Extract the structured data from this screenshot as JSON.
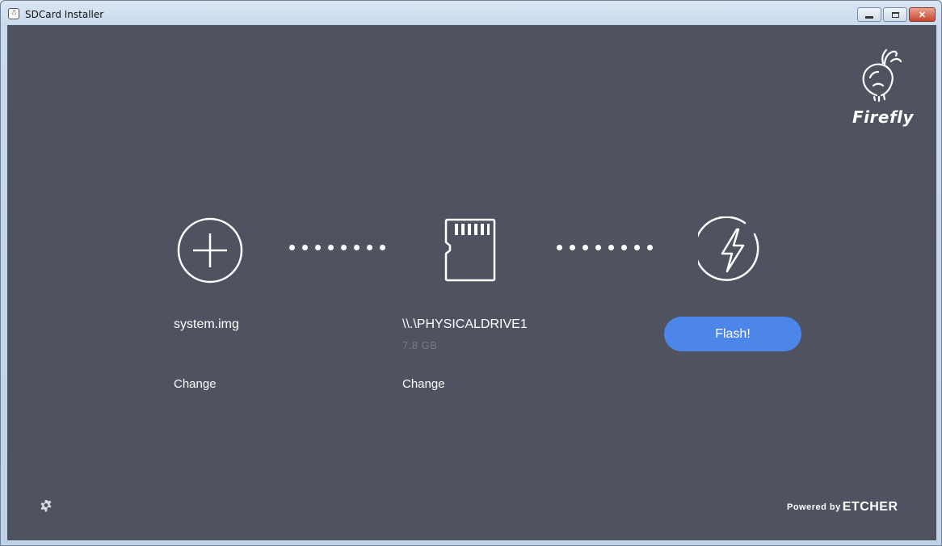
{
  "window": {
    "title": "SDCard Installer",
    "app_icon_glyph": "☃",
    "min_icon": "minimize-icon",
    "max_icon": "maximize-icon",
    "close_glyph": "✕"
  },
  "brand": {
    "logo_text": "Firefly",
    "logo_icon": "firefly-bulb-logo"
  },
  "steps": {
    "image": {
      "icon": "plus-circle-icon",
      "name": "system.img",
      "change_label": "Change"
    },
    "drive": {
      "icon": "sdcard-icon",
      "name": "\\\\.\\PHYSICALDRIVE1",
      "size": "7.8 GB",
      "change_label": "Change"
    },
    "flash": {
      "icon": "lightning-circle-icon",
      "button_label": "Flash!"
    }
  },
  "footer": {
    "settings_icon": "gear-icon",
    "powered_by": "Powered by",
    "etcher": "ETCHER"
  },
  "colors": {
    "background": "#4f5360",
    "accent": "#4d86e9",
    "muted_text": "#767b88"
  }
}
